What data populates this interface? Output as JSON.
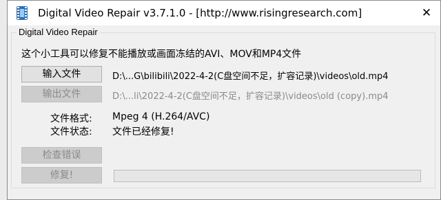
{
  "window": {
    "title": "Digital Video Repair v3.7.1.0 - [http://www.risingresearch.com]",
    "close_glyph": "✕"
  },
  "group": {
    "label": "Digital Video Repair",
    "description": "这个小工具可以修复不能播放或画面冻结的AVI、MOV和MP4文件"
  },
  "buttons": {
    "input_file": "输入文件",
    "output_file": "输出文件",
    "check_errors": "检查错误",
    "repair": "修复!"
  },
  "paths": {
    "input": "D:\\...G\\bilibili\\2022-4-2(C盘空间不足，扩容记录)\\videos\\old.mp4",
    "output": "D:\\...li\\2022-4-2(C盘空间不足，扩容记录)\\videos\\old (copy).mp4"
  },
  "info": {
    "format_label": "文件格式:",
    "format_value": "Mpeg 4 (H.264/AVC)",
    "status_label": "文件状态:",
    "status_value": "文件已经修复!"
  },
  "progress": {
    "value": 0,
    "fill_color": "#06b025"
  },
  "icons": {
    "app": "film-strip-icon",
    "close": "close-icon"
  }
}
